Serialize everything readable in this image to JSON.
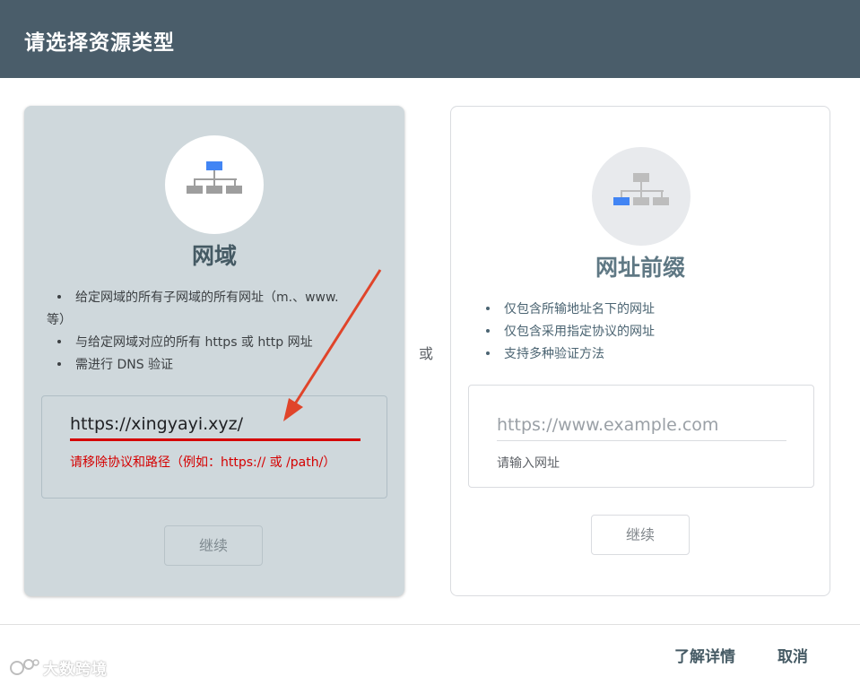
{
  "dialog": {
    "title": "请选择资源类型"
  },
  "domain_card": {
    "title": "网域",
    "bullets": [
      "给定网域的所有子网域的所有网址（m.、www. 等）",
      "与给定网域对应的所有 https 或 http 网址",
      "需进行 DNS 验证"
    ],
    "input_value": "https://xingyayi.xyz/",
    "error_text": "请移除协议和路径（例如：https:// 或 /path/）",
    "continue_label": "继续",
    "icon": "sitemap-icon",
    "highlight_color": "#4285f4"
  },
  "separator": {
    "or_label": "或"
  },
  "prefix_card": {
    "title": "网址前缀",
    "bullets": [
      "仅包含所输地址名下的网址",
      "仅包含采用指定协议的网址",
      "支持多种验证方法"
    ],
    "input_placeholder": "https://www.example.com",
    "helper_text": "请输入网址",
    "continue_label": "继续",
    "icon": "sitemap-icon"
  },
  "footer": {
    "learn_more_label": "了解详情",
    "cancel_label": "取消"
  },
  "watermark": {
    "text": "大数跨境"
  },
  "colors": {
    "header_bg": "#4a5d6a",
    "selected_card_bg": "#cfd8dc",
    "error": "#d50000",
    "annotation_arrow": "#e0442a"
  }
}
